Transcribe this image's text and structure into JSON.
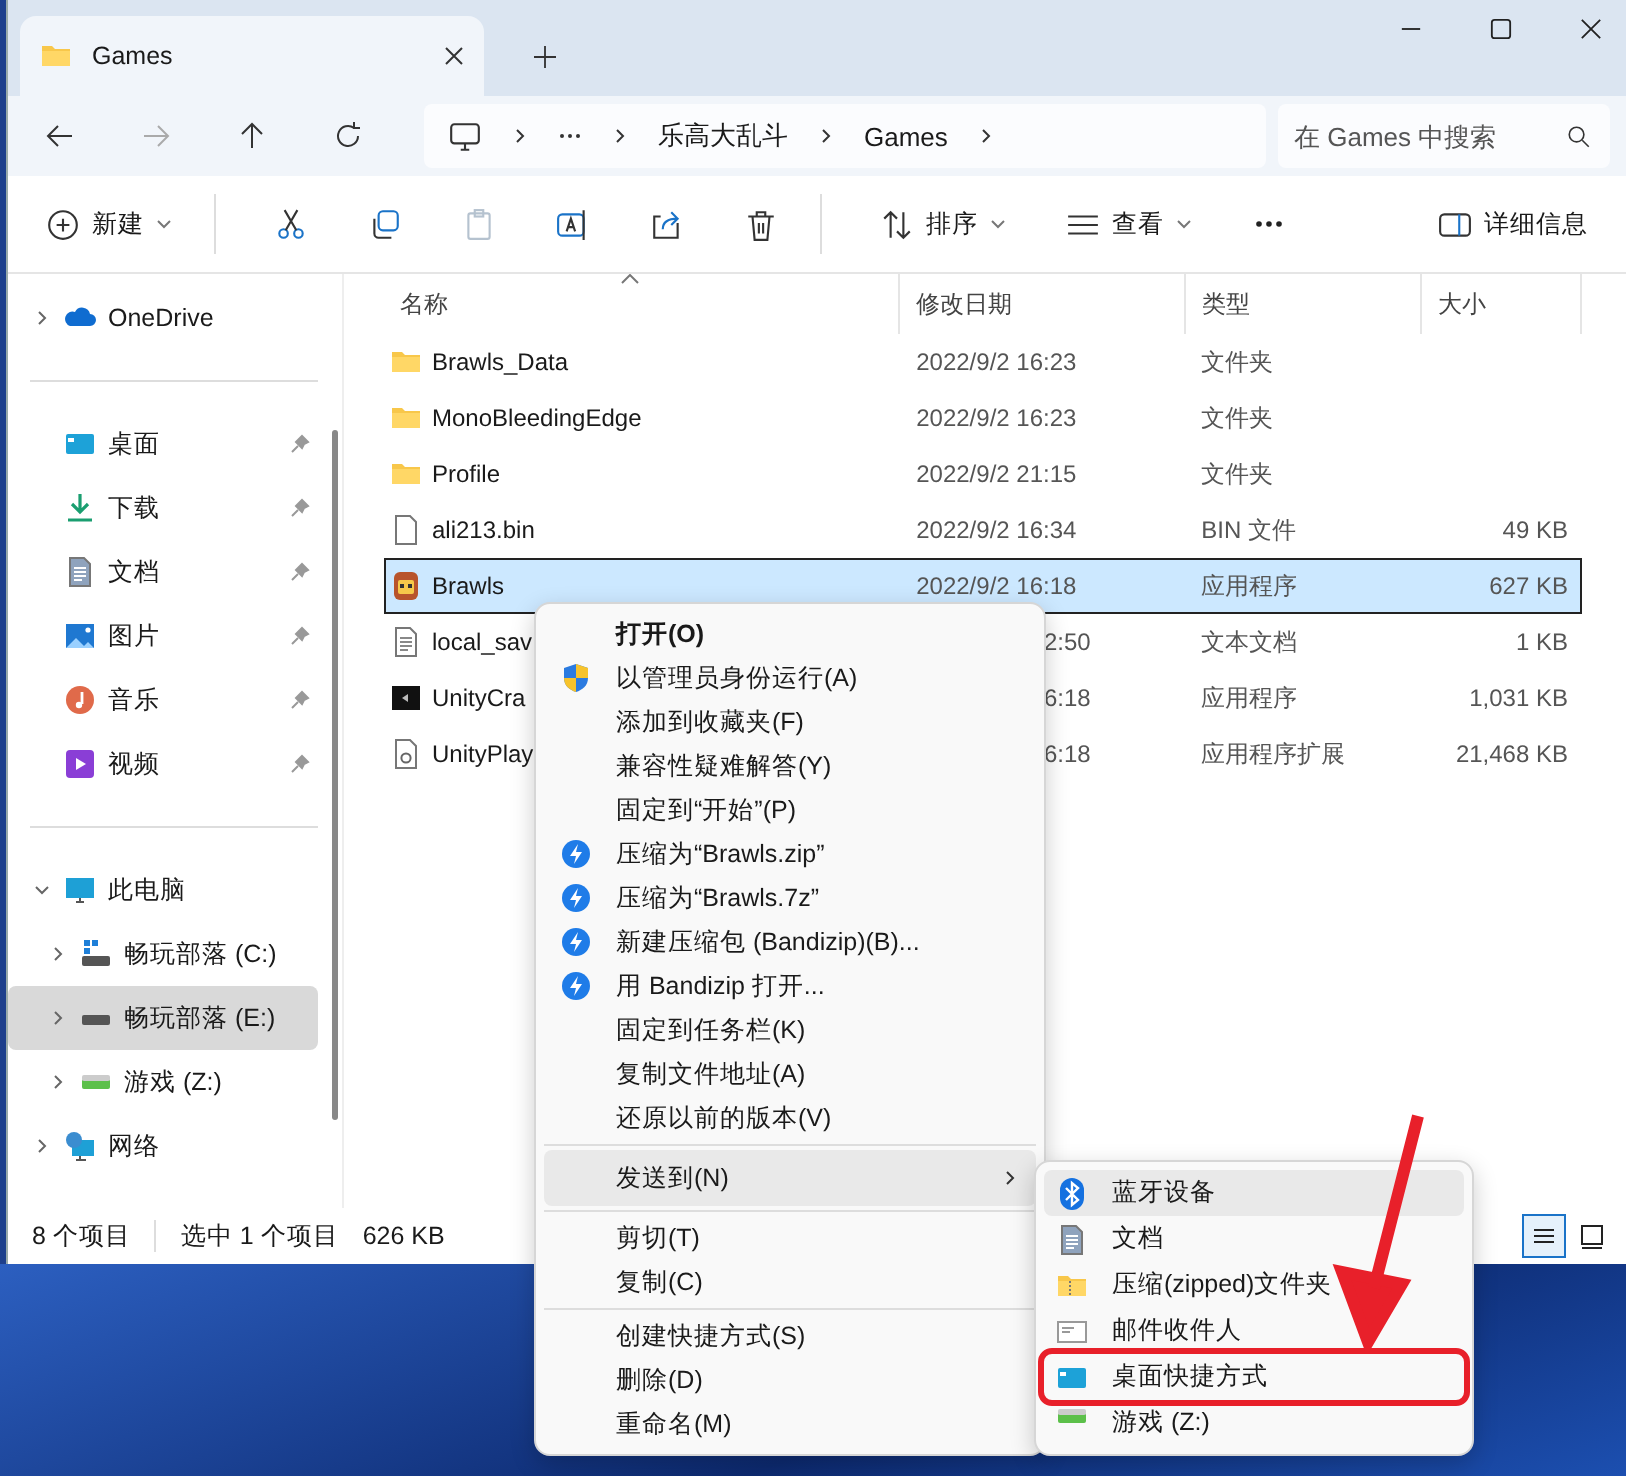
{
  "window": {
    "tab_title": "Games"
  },
  "navigation": [
    {
      "kind": "back",
      "disabled": false
    },
    {
      "kind": "forward",
      "disabled": true
    },
    {
      "kind": "up",
      "disabled": false
    },
    {
      "kind": "refresh",
      "disabled": false
    }
  ],
  "address": {
    "crumbs": [
      "乐高大乱斗",
      "Games"
    ]
  },
  "search": {
    "placeholder": "在 Games 中搜索"
  },
  "toolbar": {
    "groups": [
      [
        {
          "kind": "new",
          "label": "新建",
          "dropdown": true,
          "disabled": false
        }
      ],
      [
        {
          "kind": "cut",
          "disabled": false
        },
        {
          "kind": "copy",
          "disabled": false
        },
        {
          "kind": "paste",
          "disabled": true
        },
        {
          "kind": "rename",
          "disabled": false
        },
        {
          "kind": "share",
          "disabled": false
        },
        {
          "kind": "delete",
          "disabled": false
        }
      ],
      [
        {
          "kind": "sort",
          "label": "排序",
          "dropdown": true,
          "disabled": false
        },
        {
          "kind": "view",
          "label": "查看",
          "dropdown": true,
          "disabled": false
        },
        {
          "kind": "more",
          "disabled": false
        }
      ]
    ],
    "details": {
      "label": "详细信息"
    }
  },
  "sidebar": {
    "sections": [
      [
        {
          "label": "OneDrive",
          "kind": "cloud",
          "expanded": false,
          "pinned": false,
          "selected": false
        }
      ],
      [
        {
          "label": "桌面",
          "kind": "desktop",
          "pinned": true,
          "selected": false
        },
        {
          "label": "下载",
          "kind": "download",
          "pinned": true,
          "selected": false
        },
        {
          "label": "文档",
          "kind": "document",
          "pinned": true,
          "selected": false
        },
        {
          "label": "图片",
          "kind": "picture",
          "pinned": true,
          "selected": false
        },
        {
          "label": "音乐",
          "kind": "music",
          "pinned": true,
          "selected": false
        },
        {
          "label": "视频",
          "kind": "video",
          "pinned": true,
          "selected": false
        }
      ],
      [
        {
          "label": "此电脑",
          "kind": "pc",
          "expanded": true,
          "pinned": false,
          "selected": false,
          "children": [
            {
              "label": "畅玩部落 (C:)",
              "kind": "system-drive",
              "expanded": false,
              "pinned": false,
              "selected": false
            },
            {
              "label": "畅玩部落 (E:)",
              "kind": "drive",
              "expanded": false,
              "pinned": false,
              "selected": true
            },
            {
              "label": "游戏 (Z:)",
              "kind": "green-drive",
              "expanded": false,
              "pinned": false,
              "selected": false
            }
          ]
        },
        {
          "label": "网络",
          "kind": "network",
          "expanded": false,
          "pinned": false,
          "selected": false
        }
      ]
    ]
  },
  "files": {
    "columns": [
      "名称",
      "修改日期",
      "类型",
      "大小"
    ],
    "rows": [
      {
        "name": "Brawls_Data",
        "date": "2022/9/2 16:23",
        "type": "文件夹",
        "kind": "folder",
        "selected": false,
        "covered": false
      },
      {
        "name": "MonoBleedingEdge",
        "date": "2022/9/2 16:23",
        "type": "文件夹",
        "kind": "folder",
        "selected": false,
        "covered": false
      },
      {
        "name": "Profile",
        "date": "2022/9/2 21:15",
        "type": "文件夹",
        "kind": "folder",
        "selected": false,
        "covered": false
      },
      {
        "name": "ali213.bin",
        "date": "2022/9/2 16:34",
        "type": "BIN 文件",
        "size": "49 KB",
        "kind": "file",
        "selected": false,
        "covered": false
      },
      {
        "name": "Brawls",
        "date": "2022/9/2 16:18",
        "type": "应用程序",
        "size": "627 KB",
        "kind": "game",
        "selected": true,
        "covered": false
      },
      {
        "name": "local_sav",
        "date": "2:50",
        "type": "文本文档",
        "size": "1 KB",
        "kind": "text",
        "selected": false,
        "covered": true
      },
      {
        "name": "UnityCra",
        "date": "6:18",
        "type": "应用程序",
        "size": "1,031 KB",
        "kind": "app",
        "selected": false,
        "covered": true
      },
      {
        "name": "UnityPlay",
        "date": "6:18",
        "type": "应用程序扩展",
        "size": "21,468 KB",
        "kind": "dll",
        "selected": false,
        "covered": true
      }
    ]
  },
  "status_bar": {
    "count": "8 个项目",
    "selection": "选中 1 个项目",
    "size": "626 KB",
    "views": [
      {
        "kind": "details",
        "selected": true
      },
      {
        "kind": "tiles",
        "selected": false
      }
    ]
  },
  "context_menu": {
    "groups": [
      [
        {
          "label": "打开(O)",
          "kind": "plain",
          "default": true,
          "submenu": false,
          "selected": false
        },
        {
          "label": "以管理员身份运行(A)",
          "kind": "shield",
          "default": false,
          "submenu": false,
          "selected": false
        },
        {
          "label": "添加到收藏夹(F)",
          "kind": "plain",
          "default": false,
          "submenu": false,
          "selected": false
        },
        {
          "label": "兼容性疑难解答(Y)",
          "kind": "plain",
          "default": false,
          "submenu": false,
          "selected": false
        },
        {
          "label": "固定到“开始”(P)",
          "kind": "plain",
          "default": false,
          "submenu": false,
          "selected": false
        },
        {
          "label": "压缩为“Brawls.zip”",
          "kind": "bandizip",
          "default": false,
          "submenu": false,
          "selected": false
        },
        {
          "label": "压缩为“Brawls.7z”",
          "kind": "bandizip",
          "default": false,
          "submenu": false,
          "selected": false
        },
        {
          "label": "新建压缩包 (Bandizip)(B)...",
          "kind": "bandizip",
          "default": false,
          "submenu": false,
          "selected": false
        },
        {
          "label": "用 Bandizip 打开...",
          "kind": "bandizip",
          "default": false,
          "submenu": false,
          "selected": false
        },
        {
          "label": "固定到任务栏(K)",
          "kind": "plain",
          "default": false,
          "submenu": false,
          "selected": false
        },
        {
          "label": "复制文件地址(A)",
          "kind": "plain",
          "default": false,
          "submenu": false,
          "selected": false
        },
        {
          "label": "还原以前的版本(V)",
          "kind": "plain",
          "default": false,
          "submenu": false,
          "selected": false
        }
      ],
      [
        {
          "label": "发送到(N)",
          "kind": "plain",
          "default": false,
          "submenu": true,
          "selected": true
        }
      ],
      [
        {
          "label": "剪切(T)",
          "kind": "plain",
          "default": false,
          "submenu": false,
          "selected": false
        },
        {
          "label": "复制(C)",
          "kind": "plain",
          "default": false,
          "submenu": false,
          "selected": false
        }
      ],
      [
        {
          "label": "创建快捷方式(S)",
          "kind": "plain",
          "default": false,
          "submenu": false,
          "selected": false
        },
        {
          "label": "删除(D)",
          "kind": "plain",
          "default": false,
          "submenu": false,
          "selected": false
        },
        {
          "label": "重命名(M)",
          "kind": "plain",
          "default": false,
          "submenu": false,
          "selected": false
        }
      ]
    ]
  },
  "send_to_menu": {
    "items": [
      {
        "label": "蓝牙设备",
        "kind": "bluetooth",
        "selected": true,
        "highlighted": false
      },
      {
        "label": "文档",
        "kind": "document",
        "selected": false,
        "highlighted": false
      },
      {
        "label": "压缩(zipped)文件夹",
        "kind": "zip-folder",
        "selected": false,
        "highlighted": false
      },
      {
        "label": "邮件收件人",
        "kind": "mail",
        "selected": false,
        "highlighted": false
      },
      {
        "label": "桌面快捷方式",
        "kind": "desktop",
        "selected": false,
        "highlighted": true
      },
      {
        "label": "游戏 (Z:)",
        "kind": "green-drive",
        "selected": false,
        "highlighted": false
      }
    ]
  }
}
